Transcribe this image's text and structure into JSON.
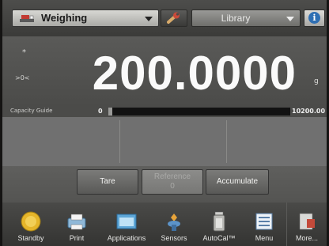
{
  "topbar": {
    "app_select_label": "Weighing",
    "app_icon": "scale-icon",
    "tool_icon": "wrench-icon",
    "library_select_label": "Library",
    "info_icon": "info-icon",
    "info_glyph": "i"
  },
  "display": {
    "stable_indicator": "*",
    "zero_indicator": ">0<",
    "weight": "200.0000",
    "unit": "g"
  },
  "capacity_guide": {
    "label": "Capacity Guide",
    "min": "0",
    "max": "10200.00",
    "fill_fraction": 0.02
  },
  "actions": {
    "tare": "Tare",
    "disabled_top": "Reference",
    "disabled_bottom": "0",
    "accumulate": "Accumulate"
  },
  "navbar": {
    "items": [
      {
        "label": "Standby",
        "icon": "standby-icon"
      },
      {
        "label": "Print",
        "icon": "printer-icon"
      },
      {
        "label": "Applications",
        "icon": "applications-icon"
      },
      {
        "label": "Sensors",
        "icon": "sensors-icon"
      },
      {
        "label": "AutoCal™",
        "icon": "autocal-icon"
      },
      {
        "label": "Menu",
        "icon": "menu-icon"
      },
      {
        "label": "More...",
        "icon": "more-icon"
      }
    ]
  },
  "colors": {
    "background": "#6a6a68",
    "weight_text": "#fafafa",
    "info_blue": "#2f6fb3",
    "standby_yellow": "#e5b52a"
  }
}
